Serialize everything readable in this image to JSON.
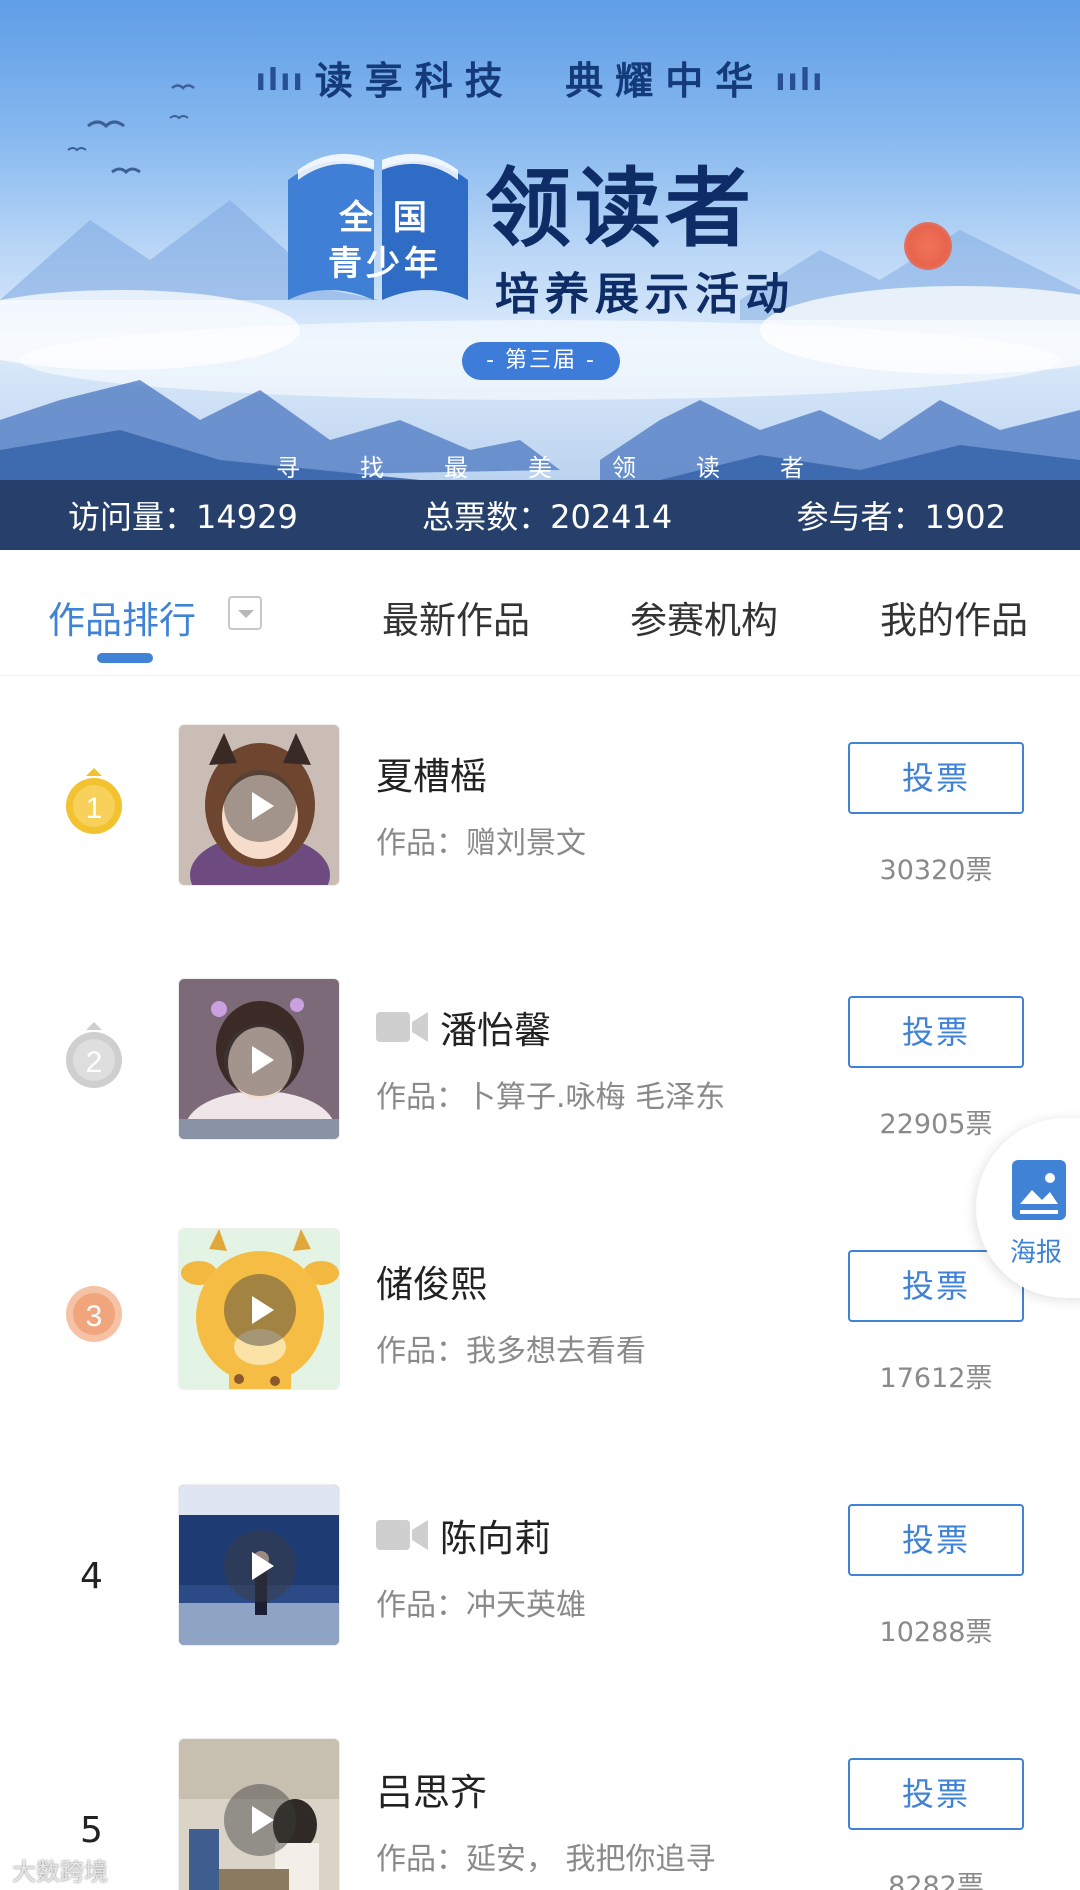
{
  "banner": {
    "slogan_left": "读享科技",
    "slogan_right": "典耀中华",
    "book_line1": "全 国",
    "book_line2": "青少年",
    "title_main": "领读者",
    "title_sub": "培养展示活动",
    "edition": "- 第三届 -",
    "motto": [
      "寻",
      "找",
      "最",
      "美",
      "领",
      "读",
      "者"
    ]
  },
  "stats": {
    "visits": "访问量：14929",
    "total_votes": "总票数：202414",
    "participants": "参与者：1902"
  },
  "tabs": {
    "ranking": "作品排行",
    "latest": "最新作品",
    "institutions": "参赛机构",
    "mine": "我的作品"
  },
  "entries": [
    {
      "rank": "1",
      "name": "夏槽榣",
      "work": "作品：赠刘景文",
      "vote_label": "投票",
      "votes": "30320票",
      "video": false
    },
    {
      "rank": "2",
      "name": "潘怡馨",
      "work": "作品：卜算子.咏梅 毛泽东",
      "vote_label": "投票",
      "votes": "22905票",
      "video": true
    },
    {
      "rank": "3",
      "name": "储俊熙",
      "work": "作品：我多想去看看",
      "vote_label": "投票",
      "votes": "17612票",
      "video": false
    },
    {
      "rank": "4",
      "name": "陈向莉",
      "work": "作品：冲天英雄",
      "vote_label": "投票",
      "votes": "10288票",
      "video": true
    },
    {
      "rank": "5",
      "name": "吕思齐",
      "work": "作品：延安， 我把你追寻",
      "vote_label": "投票",
      "votes": "8282票",
      "video": false
    }
  ],
  "poster": {
    "label": "海报",
    "icon": "poster-image-icon"
  },
  "watermark": "大数跨境",
  "colors": {
    "accent": "#3f82d6",
    "stats_bar": "#26406b",
    "gold": "#f2c230",
    "silver": "#cfcfcf",
    "bronze": "#f0a57c"
  }
}
